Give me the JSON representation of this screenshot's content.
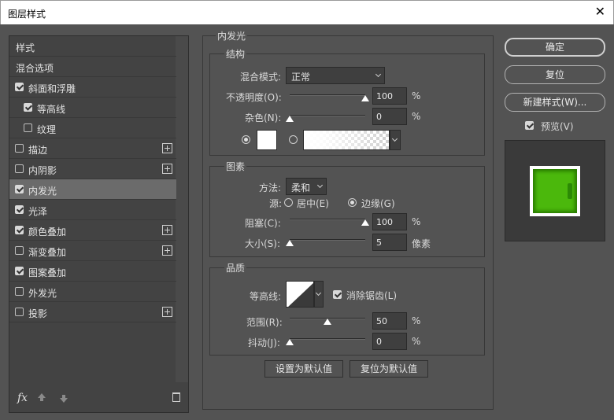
{
  "window": {
    "title": "图层样式",
    "close": "✕"
  },
  "left_panel": {
    "items": [
      {
        "label": "样式",
        "checkbox": null,
        "plus": false,
        "indent": false
      },
      {
        "label": "混合选项",
        "checkbox": null,
        "plus": false,
        "indent": false
      },
      {
        "label": "斜面和浮雕",
        "checkbox": true,
        "plus": false,
        "indent": false
      },
      {
        "label": "等高线",
        "checkbox": true,
        "plus": false,
        "indent": true
      },
      {
        "label": "纹理",
        "checkbox": false,
        "plus": false,
        "indent": true
      },
      {
        "label": "描边",
        "checkbox": false,
        "plus": true,
        "indent": false
      },
      {
        "label": "内阴影",
        "checkbox": false,
        "plus": true,
        "indent": false
      },
      {
        "label": "内发光",
        "checkbox": true,
        "plus": false,
        "indent": false,
        "selected": true
      },
      {
        "label": "光泽",
        "checkbox": true,
        "plus": false,
        "indent": false
      },
      {
        "label": "颜色叠加",
        "checkbox": true,
        "plus": true,
        "indent": false
      },
      {
        "label": "渐变叠加",
        "checkbox": false,
        "plus": true,
        "indent": false
      },
      {
        "label": "图案叠加",
        "checkbox": true,
        "plus": false,
        "indent": false
      },
      {
        "label": "外发光",
        "checkbox": false,
        "plus": false,
        "indent": false
      },
      {
        "label": "投影",
        "checkbox": false,
        "plus": true,
        "indent": false
      }
    ],
    "fx_label": "fx"
  },
  "inner_glow": {
    "title": "内发光",
    "structure": {
      "title": "结构",
      "blend_mode_label": "混合模式:",
      "blend_mode_value": "正常",
      "opacity_label": "不透明度(O):",
      "opacity_value": "100",
      "opacity_unit": "%",
      "opacity_level": 1.0,
      "noise_label": "杂色(N):",
      "noise_value": "0",
      "noise_unit": "%",
      "noise_level": 0.0
    },
    "elements": {
      "title": "图素",
      "method_label": "方法:",
      "method_value": "柔和",
      "source_label": "源:",
      "center_label": "居中(E)",
      "edge_label": "边缘(G)",
      "choke_label": "阻塞(C):",
      "choke_value": "100",
      "choke_unit": "%",
      "choke_level": 1.0,
      "size_label": "大小(S):",
      "size_value": "5",
      "size_unit": "像素",
      "size_level": 0.0
    },
    "quality": {
      "title": "品质",
      "contour_label": "等高线:",
      "antialias_label": "消除锯齿(L)",
      "range_label": "范围(R):",
      "range_value": "50",
      "range_unit": "%",
      "range_level": 0.5,
      "jitter_label": "抖动(J):",
      "jitter_value": "0",
      "jitter_unit": "%",
      "jitter_level": 0.0
    },
    "set_default_label": "设置为默认值",
    "reset_default_label": "复位为默认值"
  },
  "right_panel": {
    "ok_label": "确定",
    "reset_label": "复位",
    "new_style_label": "新建样式(W)...",
    "preview_label": "预览(V)"
  },
  "colors": {
    "preview_green": "#4bb80c",
    "glow_color": "#ffffff"
  }
}
